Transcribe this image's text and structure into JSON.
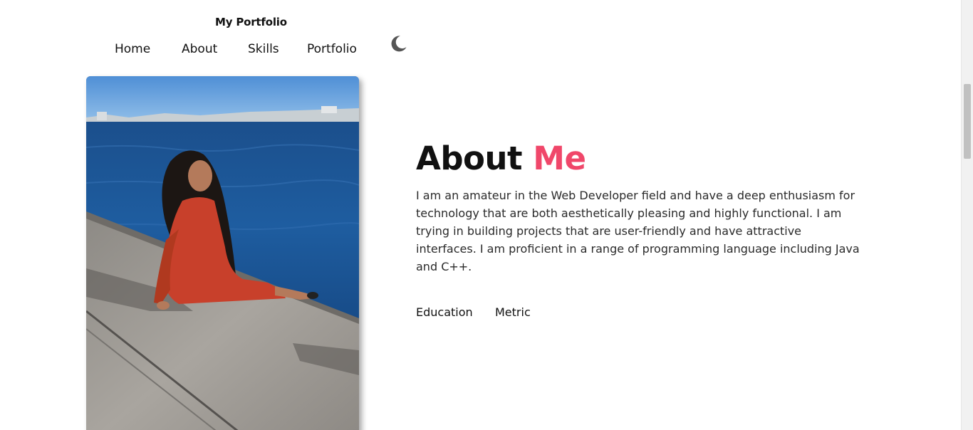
{
  "header": {
    "brand": "My Portfolio",
    "nav": [
      {
        "label": "Home"
      },
      {
        "label": "About"
      },
      {
        "label": "Skills"
      },
      {
        "label": "Portfolio"
      }
    ],
    "theme_toggle_icon": "moon-icon"
  },
  "about": {
    "title_main": "About",
    "title_accent": "Me",
    "accent_color": "#f0476a",
    "description": "I am an amateur in the Web Developer field and have a deep enthusiasm for technology that are both aesthetically pleasing and highly functional. I am trying in building projects that are user-friendly and have attractive interfaces. I am proficient in a range of programming language including Java and C++.",
    "tabs": [
      {
        "label": "Education"
      },
      {
        "label": "Metric"
      }
    ]
  }
}
